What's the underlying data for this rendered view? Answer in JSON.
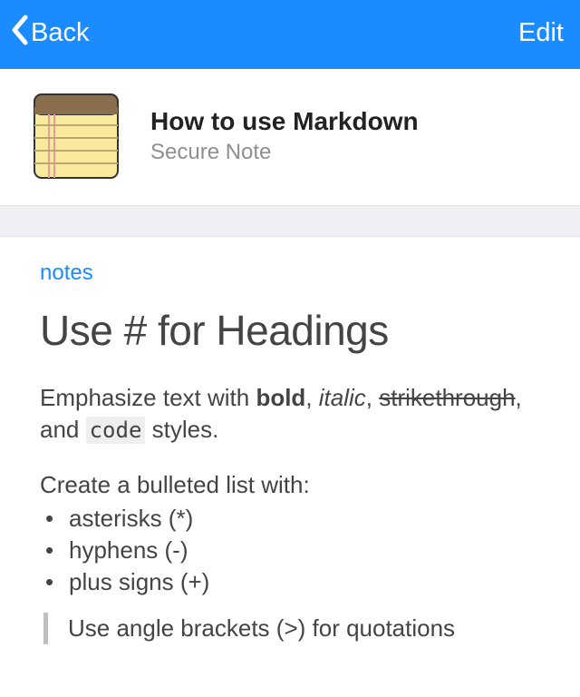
{
  "nav": {
    "back_label": "Back",
    "edit_label": "Edit"
  },
  "header": {
    "title": "How to use Markdown",
    "subtitle": "Secure Note"
  },
  "content": {
    "field_label": "notes",
    "heading": "Use # for Headings",
    "emphasis": {
      "prefix": "Emphasize text with ",
      "bold": "bold",
      "sep1": ", ",
      "italic": "italic",
      "sep2": ", ",
      "strike": "strikethrough",
      "sep3": ", and ",
      "code": "code",
      "suffix": " styles."
    },
    "list_intro": "Create a bulleted list with:",
    "bullets": [
      "asterisks (*)",
      "hyphens (-)",
      "plus signs (+)"
    ],
    "blockquote": "Use angle brackets (>) for quotations"
  }
}
